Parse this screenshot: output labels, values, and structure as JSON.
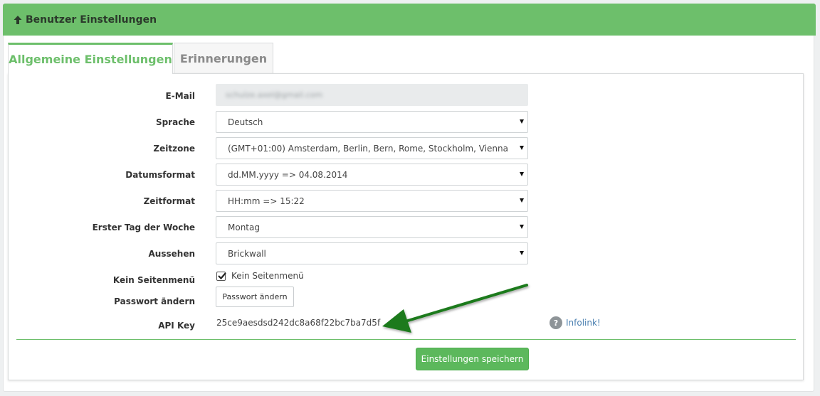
{
  "header": {
    "title": "Benutzer Einstellungen",
    "icon": "arrow-up-icon"
  },
  "tabs": [
    {
      "label": "Allgemeine Einstellungen",
      "active": true
    },
    {
      "label": "Erinnerungen",
      "active": false
    }
  ],
  "form": {
    "email": {
      "label": "E-Mail",
      "value": "schulze.axel@gmail.com"
    },
    "sprache": {
      "label": "Sprache",
      "value": "Deutsch"
    },
    "zeitzone": {
      "label": "Zeitzone",
      "value": "(GMT+01:00) Amsterdam, Berlin, Bern, Rome, Stockholm, Vienna"
    },
    "datumsformat": {
      "label": "Datumsformat",
      "value": "dd.MM.yyyy => 04.08.2014"
    },
    "zeitformat": {
      "label": "Zeitformat",
      "value": "HH:mm => 15:22"
    },
    "erster_tag": {
      "label": "Erster Tag der Woche",
      "value": "Montag"
    },
    "aussehen": {
      "label": "Aussehen",
      "value": "Brickwall"
    },
    "kein_seitenmenu": {
      "label": "Kein Seitenmenü",
      "checkbox_label": "Kein Seitenmenü",
      "checked": true
    },
    "passwort": {
      "label": "Passwort ändern",
      "button_label": "Passwort ändern"
    },
    "api_key": {
      "label": "API Key",
      "value": "25ce9aesdsd242dc8a68f22bc7ba7d5f"
    }
  },
  "info": {
    "icon_text": "?",
    "link_label": "Infolink!"
  },
  "save_button": {
    "label": "Einstellungen speichern"
  },
  "colors": {
    "accent": "#6dbf6b",
    "button": "#5cb85c",
    "arrow": "#1a7a1a",
    "link": "#4a7fb0"
  }
}
